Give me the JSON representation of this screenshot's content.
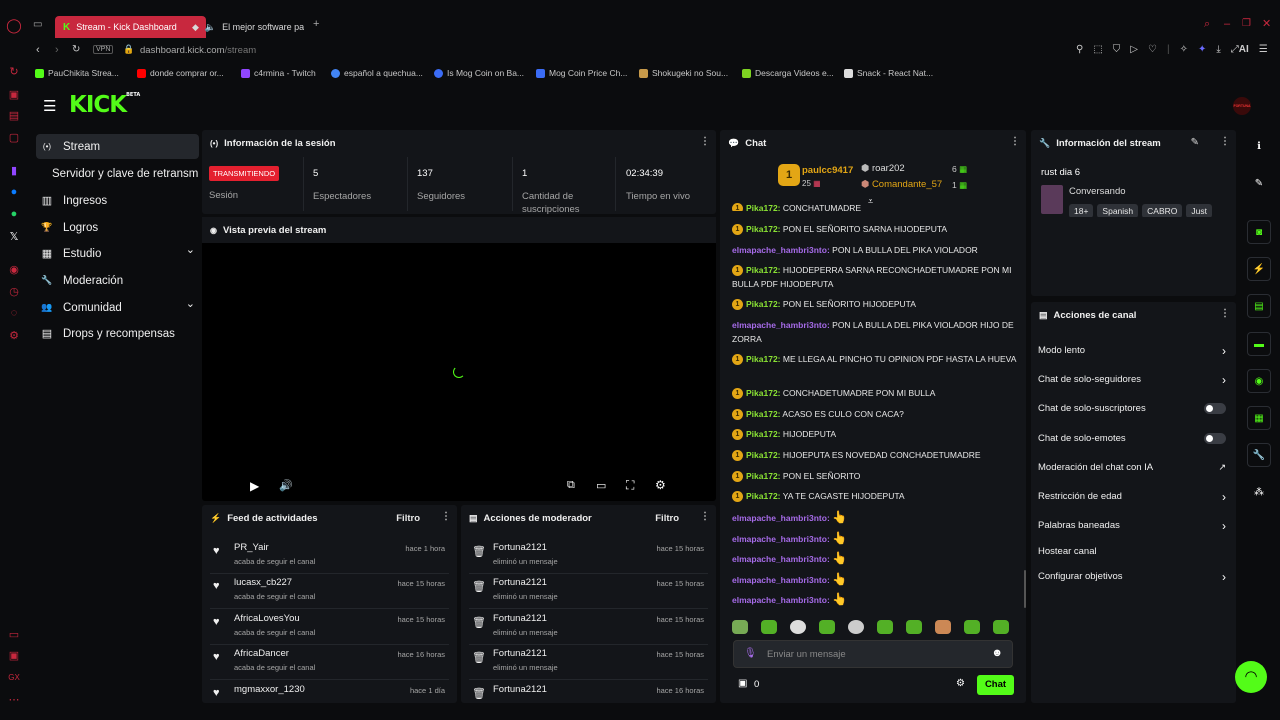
{
  "browser": {
    "tabs": [
      {
        "label": "Stream - Kick Dashboard",
        "active": true
      },
      {
        "label": "El mejor software para",
        "active": false
      }
    ],
    "address": {
      "vpn": "VPN",
      "domain": "dashboard.kick.com",
      "path": "/stream"
    },
    "bookmarks": [
      "PauChikita Strea...",
      "donde comprar or...",
      "c4rmina - Twitch",
      "español a quechua...",
      "Is Mog Coin on Ba...",
      "Mog Coin Price Ch...",
      "Shokugeki no Sou...",
      "Descarga Videos e...",
      "Snack - React Nat..."
    ],
    "ai_label": "AI"
  },
  "kick": {
    "logo": "KICK",
    "logo_sup": "BETA",
    "avatar_text": "FORTUNA",
    "accent": "#53fc18"
  },
  "sidebar": {
    "items": [
      {
        "label": "Stream",
        "icon": "broadcast-icon",
        "glyph": "(•)",
        "active": true
      },
      {
        "label": "Servidor y clave de retransmisión",
        "icon": "",
        "glyph": "",
        "active": false
      },
      {
        "label": "Ingresos",
        "icon": "chart-icon",
        "glyph": "▥",
        "active": false
      },
      {
        "label": "Logros",
        "icon": "trophy-icon",
        "glyph": "🏆",
        "active": false
      },
      {
        "label": "Estudio",
        "icon": "studio-icon",
        "glyph": "▦",
        "active": false,
        "chevron": "⌄"
      },
      {
        "label": "Moderación",
        "icon": "wrench-icon",
        "glyph": "🔧",
        "active": false
      },
      {
        "label": "Comunidad",
        "icon": "people-icon",
        "glyph": "👥",
        "active": false,
        "chevron": "⌄"
      },
      {
        "label": "Drops y recompensas",
        "icon": "gift-icon",
        "glyph": "▤",
        "active": false
      }
    ]
  },
  "session": {
    "title": "Información de la sesión",
    "live_badge": "TRANSMITIENDO",
    "session_label": "Sesión",
    "stats": [
      {
        "value": "5",
        "label": "Espectadores"
      },
      {
        "value": "137",
        "label": "Seguidores"
      },
      {
        "value": "1",
        "label": "Cantidad de suscripciones"
      },
      {
        "value": "02:34:39",
        "label": "Tiempo en vivo"
      }
    ]
  },
  "preview": {
    "title": "Vista previa del stream"
  },
  "feed": {
    "title": "Feed de actividades",
    "filter": "Filtro",
    "rows": [
      {
        "user": "PR_Yair",
        "action": "acaba de seguir el canal",
        "time": "hace 1 hora"
      },
      {
        "user": "lucasx_cb227",
        "action": "acaba de seguir el canal",
        "time": "hace 15 horas"
      },
      {
        "user": "AfricaLovesYou",
        "action": "acaba de seguir el canal",
        "time": "hace 15 horas"
      },
      {
        "user": "AfricaDancer",
        "action": "acaba de seguir el canal",
        "time": "hace 16 horas"
      },
      {
        "user": "mgmaxxor_1230",
        "action": "",
        "time": "hace 1 día"
      }
    ]
  },
  "modactions": {
    "title": "Acciones de moderador",
    "filter": "Filtro",
    "rows": [
      {
        "user": "Fortuna2121",
        "action": "eliminó un mensaje",
        "time": "hace 15 horas"
      },
      {
        "user": "Fortuna2121",
        "action": "eliminó un mensaje",
        "time": "hace 15 horas"
      },
      {
        "user": "Fortuna2121",
        "action": "eliminó un mensaje",
        "time": "hace 15 horas"
      },
      {
        "user": "Fortuna2121",
        "action": "eliminó un mensaje",
        "time": "hace 15 horas"
      },
      {
        "user": "Fortuna2121",
        "action": "",
        "time": "hace 16 horas"
      }
    ]
  },
  "chat": {
    "title": "Chat",
    "top_gifters": [
      {
        "rank": "1",
        "name": "paulcc9417",
        "count": "25"
      },
      {
        "rank": "",
        "name": "roar202",
        "count": "6"
      },
      {
        "rank": "",
        "name": "Comandante_57",
        "count": "1"
      }
    ],
    "messages": [
      {
        "user": "Pika172:",
        "text": "CONCHATUMADRE",
        "type": "p",
        "partial": true
      },
      {
        "user": "Pika172:",
        "text": "PON EL SEÑORITO SARNA HIJODEPUTA",
        "type": "p"
      },
      {
        "user": "elmapache_hambri3nto:",
        "text": "PON LA BULLA DEL PIKA VIOLADOR",
        "type": "m"
      },
      {
        "user": "Pika172:",
        "text": "HIJODEPERRA SARNA RECONCHADETUMADRE PON MI BULLA PDF HIJODEPUTA",
        "type": "p"
      },
      {
        "user": "Pika172:",
        "text": "PON EL SEÑORITO HIJODEPUTA",
        "type": "p"
      },
      {
        "user": "elmapache_hambri3nto:",
        "text": "PON LA BULLA DEL PIKA VIOLADOR HIJO DE ZORRA",
        "type": "m"
      },
      {
        "user": "Pika172:",
        "text": "ME LLEGA AL PINCHO TU OPINION PDF HASTA LA HUEVA",
        "type": "p"
      },
      {
        "user": "Pika172:",
        "text": "CONCHADETUMADRE PON MI BULLA",
        "type": "p"
      },
      {
        "user": "Pika172:",
        "text": "ACASO ES CULO CON CACA?",
        "type": "p"
      },
      {
        "user": "Pika172:",
        "text": "HIJODEPUTA",
        "type": "p"
      },
      {
        "user": "Pika172:",
        "text": "HIJOEPUTA ES NOVEDAD CONCHADETUMADRE",
        "type": "p"
      },
      {
        "user": "Pika172:",
        "text": "PON EL SEÑORITO",
        "type": "p"
      },
      {
        "user": "Pika172:",
        "text": "YA TE CAGASTE HIJODEPUTA",
        "type": "p"
      },
      {
        "user": "elmapache_hambri3nto:",
        "text": "👆",
        "type": "m"
      },
      {
        "user": "elmapache_hambri3nto:",
        "text": "👆",
        "type": "m"
      },
      {
        "user": "elmapache_hambri3nto:",
        "text": "👆",
        "type": "m"
      },
      {
        "user": "elmapache_hambri3nto:",
        "text": "👆",
        "type": "m"
      },
      {
        "user": "elmapache_hambri3nto:",
        "text": "👆",
        "type": "m"
      }
    ],
    "input_placeholder": "Enviar un mensaje",
    "points": "0",
    "send_label": "Chat"
  },
  "stream_info": {
    "title": "Información del stream",
    "stream_title": "rust dia 6",
    "category": "Conversando",
    "tags": [
      "18+",
      "Spanish",
      "CABRO",
      "Just"
    ]
  },
  "channel_actions": {
    "title": "Acciones de canal",
    "items": [
      {
        "label": "Modo lento",
        "control": "chevron"
      },
      {
        "label": "Chat de solo-seguidores",
        "control": "chevron"
      },
      {
        "label": "Chat de solo-suscriptores",
        "control": "toggle"
      },
      {
        "label": "Chat de solo-emotes",
        "control": "toggle"
      },
      {
        "label": "Moderación del chat con IA",
        "control": "external"
      },
      {
        "label": "Restricción de edad",
        "control": "chevron"
      },
      {
        "label": "Palabras baneadas",
        "control": "chevron"
      },
      {
        "label": "Hostear canal",
        "control": "none"
      },
      {
        "label": "Configurar objetivos",
        "control": "chevron"
      }
    ]
  }
}
